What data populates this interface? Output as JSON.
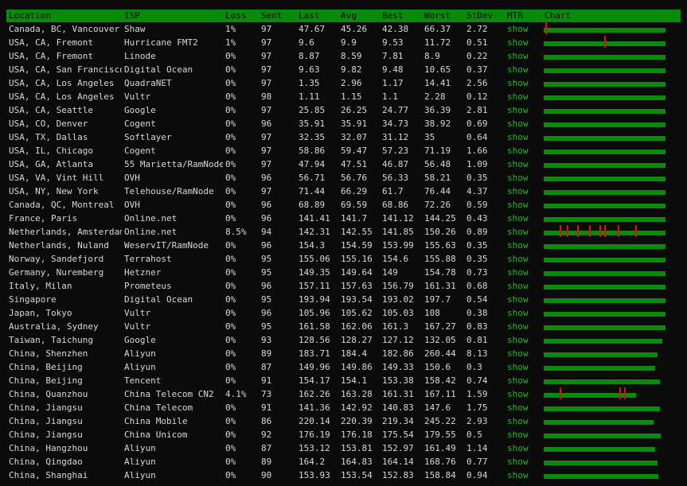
{
  "headers": [
    "Location",
    "ISP",
    "Loss",
    "Sent",
    "Last",
    "Avg",
    "Best",
    "Worst",
    "StDev",
    "MTR",
    "Chart"
  ],
  "mtr_label": "show",
  "colors": {
    "header_bg": "#0a8a0a",
    "bar": "#0c8a0c",
    "spike": "#e01010",
    "link": "#1fbf1f"
  },
  "rows": [
    {
      "location": "Canada, BC, Vancouver",
      "isp": "Shaw",
      "loss": "1%",
      "sent": "97",
      "last": "47.67",
      "avg": "45.26",
      "best": "42.38",
      "worst": "66.37",
      "stdev": "2.72",
      "bar": 0.99,
      "spikes": [
        0.01
      ]
    },
    {
      "location": "USA, CA, Fremont",
      "isp": "Hurricane FMT2",
      "loss": "1%",
      "sent": "97",
      "last": "9.6",
      "avg": "9.9",
      "best": "9.53",
      "worst": "11.72",
      "stdev": "0.51",
      "bar": 0.99,
      "spikes": [
        0.49
      ]
    },
    {
      "location": "USA, CA, Fremont",
      "isp": "Linode",
      "loss": "0%",
      "sent": "97",
      "last": "8.87",
      "avg": "8.59",
      "best": "7.81",
      "worst": "8.9",
      "stdev": "0.22",
      "bar": 0.99,
      "spikes": []
    },
    {
      "location": "USA, CA, San Francisco",
      "isp": "Digital Ocean",
      "loss": "0%",
      "sent": "97",
      "last": "9.63",
      "avg": "9.82",
      "best": "9.48",
      "worst": "10.65",
      "stdev": "0.37",
      "bar": 0.99,
      "spikes": []
    },
    {
      "location": "USA, CA, Los Angeles",
      "isp": "QuadraNET",
      "loss": "0%",
      "sent": "97",
      "last": "1.35",
      "avg": "2.96",
      "best": "1.17",
      "worst": "14.41",
      "stdev": "2.56",
      "bar": 0.99,
      "spikes": []
    },
    {
      "location": "USA, CA, Los Angeles",
      "isp": "Vultr",
      "loss": "0%",
      "sent": "98",
      "last": "1.11",
      "avg": "1.15",
      "best": "1.1",
      "worst": "2.28",
      "stdev": "0.12",
      "bar": 0.99,
      "spikes": []
    },
    {
      "location": "USA, CA, Seattle",
      "isp": "Google",
      "loss": "0%",
      "sent": "97",
      "last": "25.85",
      "avg": "26.25",
      "best": "24.77",
      "worst": "36.39",
      "stdev": "2.81",
      "bar": 0.99,
      "spikes": []
    },
    {
      "location": "USA, CO, Denver",
      "isp": "Cogent",
      "loss": "0%",
      "sent": "96",
      "last": "35.91",
      "avg": "35.91",
      "best": "34.73",
      "worst": "38.92",
      "stdev": "0.69",
      "bar": 0.99,
      "spikes": []
    },
    {
      "location": "USA, TX, Dallas",
      "isp": "Softlayer",
      "loss": "0%",
      "sent": "97",
      "last": "32.35",
      "avg": "32.07",
      "best": "31.12",
      "worst": "35",
      "stdev": "0.64",
      "bar": 0.99,
      "spikes": []
    },
    {
      "location": "USA, IL, Chicago",
      "isp": "Cogent",
      "loss": "0%",
      "sent": "97",
      "last": "58.86",
      "avg": "59.47",
      "best": "57.23",
      "worst": "71.19",
      "stdev": "1.66",
      "bar": 0.99,
      "spikes": []
    },
    {
      "location": "USA, GA, Atlanta",
      "isp": "55 Marietta/RamNode",
      "loss": "0%",
      "sent": "97",
      "last": "47.94",
      "avg": "47.51",
      "best": "46.87",
      "worst": "56.48",
      "stdev": "1.09",
      "bar": 0.99,
      "spikes": []
    },
    {
      "location": "USA, VA, Vint Hill",
      "isp": "OVH",
      "loss": "0%",
      "sent": "96",
      "last": "56.71",
      "avg": "56.76",
      "best": "56.33",
      "worst": "58.21",
      "stdev": "0.35",
      "bar": 0.99,
      "spikes": []
    },
    {
      "location": "USA, NY, New York",
      "isp": "Telehouse/RamNode",
      "loss": "0%",
      "sent": "97",
      "last": "71.44",
      "avg": "66.29",
      "best": "61.7",
      "worst": "76.44",
      "stdev": "4.37",
      "bar": 0.99,
      "spikes": []
    },
    {
      "location": "Canada, QC, Montreal",
      "isp": "OVH",
      "loss": "0%",
      "sent": "96",
      "last": "68.89",
      "avg": "69.59",
      "best": "68.86",
      "worst": "72.26",
      "stdev": "0.59",
      "bar": 0.99,
      "spikes": []
    },
    {
      "location": "France, Paris",
      "isp": "Online.net",
      "loss": "0%",
      "sent": "96",
      "last": "141.41",
      "avg": "141.7",
      "best": "141.12",
      "worst": "144.25",
      "stdev": "0.43",
      "bar": 0.99,
      "spikes": []
    },
    {
      "location": "Netherlands, Amsterdam",
      "isp": "Online.net",
      "loss": "8.5%",
      "sent": "94",
      "last": "142.31",
      "avg": "142.55",
      "best": "141.85",
      "worst": "150.26",
      "stdev": "0.89",
      "bar": 0.99,
      "spikes": [
        0.13,
        0.19,
        0.27,
        0.37,
        0.45,
        0.49,
        0.6,
        0.74
      ]
    },
    {
      "location": "Netherlands, Nuland",
      "isp": "WeservIT/RamNode",
      "loss": "0%",
      "sent": "96",
      "last": "154.3",
      "avg": "154.59",
      "best": "153.99",
      "worst": "155.63",
      "stdev": "0.35",
      "bar": 0.99,
      "spikes": []
    },
    {
      "location": "Norway, Sandefjord",
      "isp": "Terrahost",
      "loss": "0%",
      "sent": "95",
      "last": "155.06",
      "avg": "155.16",
      "best": "154.6",
      "worst": "155.88",
      "stdev": "0.35",
      "bar": 0.99,
      "spikes": []
    },
    {
      "location": "Germany, Nuremberg",
      "isp": "Hetzner",
      "loss": "0%",
      "sent": "95",
      "last": "149.35",
      "avg": "149.64",
      "best": "149",
      "worst": "154.78",
      "stdev": "0.73",
      "bar": 0.99,
      "spikes": []
    },
    {
      "location": "Italy, Milan",
      "isp": "Prometeus",
      "loss": "0%",
      "sent": "96",
      "last": "157.11",
      "avg": "157.63",
      "best": "156.79",
      "worst": "161.31",
      "stdev": "0.68",
      "bar": 0.99,
      "spikes": []
    },
    {
      "location": "Singapore",
      "isp": "Digital Ocean",
      "loss": "0%",
      "sent": "95",
      "last": "193.94",
      "avg": "193.54",
      "best": "193.02",
      "worst": "197.7",
      "stdev": "0.54",
      "bar": 0.99,
      "spikes": []
    },
    {
      "location": "Japan, Tokyo",
      "isp": "Vultr",
      "loss": "0%",
      "sent": "96",
      "last": "105.96",
      "avg": "105.62",
      "best": "105.03",
      "worst": "108",
      "stdev": "0.38",
      "bar": 0.99,
      "spikes": []
    },
    {
      "location": "Australia, Sydney",
      "isp": "Vultr",
      "loss": "0%",
      "sent": "95",
      "last": "161.58",
      "avg": "162.06",
      "best": "161.3",
      "worst": "167.27",
      "stdev": "0.83",
      "bar": 0.99,
      "spikes": []
    },
    {
      "location": "Taiwan, Taichung",
      "isp": "Google",
      "loss": "0%",
      "sent": "93",
      "last": "128.56",
      "avg": "128.27",
      "best": "127.12",
      "worst": "132.05",
      "stdev": "0.81",
      "bar": 0.96,
      "spikes": []
    },
    {
      "location": "China, Shenzhen",
      "isp": "Aliyun",
      "loss": "0%",
      "sent": "89",
      "last": "183.71",
      "avg": "184.4",
      "best": "182.86",
      "worst": "260.44",
      "stdev": "8.13",
      "bar": 0.92,
      "spikes": []
    },
    {
      "location": "China, Beijing",
      "isp": "Aliyun",
      "loss": "0%",
      "sent": "87",
      "last": "149.96",
      "avg": "149.86",
      "best": "149.33",
      "worst": "150.6",
      "stdev": "0.3",
      "bar": 0.9,
      "spikes": []
    },
    {
      "location": "China, Beijing",
      "isp": "Tencent",
      "loss": "0%",
      "sent": "91",
      "last": "154.17",
      "avg": "154.1",
      "best": "153.38",
      "worst": "158.42",
      "stdev": "0.74",
      "bar": 0.94,
      "spikes": []
    },
    {
      "location": "China, Quanzhou",
      "isp": "China Telecom CN2",
      "loss": "4.1%",
      "sent": "73",
      "last": "162.26",
      "avg": "163.28",
      "best": "161.31",
      "worst": "167.11",
      "stdev": "1.59",
      "bar": 0.75,
      "spikes": [
        0.13,
        0.61,
        0.65
      ]
    },
    {
      "location": "China, Jiangsu",
      "isp": "China Telecom",
      "loss": "0%",
      "sent": "91",
      "last": "141.36",
      "avg": "142.92",
      "best": "140.83",
      "worst": "147.6",
      "stdev": "1.75",
      "bar": 0.94,
      "spikes": []
    },
    {
      "location": "China, Jiangsu",
      "isp": "China Mobile",
      "loss": "0%",
      "sent": "86",
      "last": "220.14",
      "avg": "220.39",
      "best": "219.34",
      "worst": "245.22",
      "stdev": "2.93",
      "bar": 0.89,
      "spikes": []
    },
    {
      "location": "China, Jiangsu",
      "isp": "China Unicom",
      "loss": "0%",
      "sent": "92",
      "last": "176.19",
      "avg": "176.18",
      "best": "175.54",
      "worst": "179.55",
      "stdev": "0.5",
      "bar": 0.95,
      "spikes": []
    },
    {
      "location": "China, Hangzhou",
      "isp": "Aliyun",
      "loss": "0%",
      "sent": "87",
      "last": "153.12",
      "avg": "153.81",
      "best": "152.97",
      "worst": "161.49",
      "stdev": "1.14",
      "bar": 0.9,
      "spikes": []
    },
    {
      "location": "China, Qingdao",
      "isp": "Aliyun",
      "loss": "0%",
      "sent": "89",
      "last": "164.2",
      "avg": "164.83",
      "best": "164.14",
      "worst": "168.76",
      "stdev": "0.77",
      "bar": 0.92,
      "spikes": []
    },
    {
      "location": "China, Shanghai",
      "isp": "Aliyun",
      "loss": "0%",
      "sent": "90",
      "last": "153.93",
      "avg": "153.54",
      "best": "152.83",
      "worst": "158.84",
      "stdev": "0.94",
      "bar": 0.93,
      "spikes": []
    }
  ]
}
